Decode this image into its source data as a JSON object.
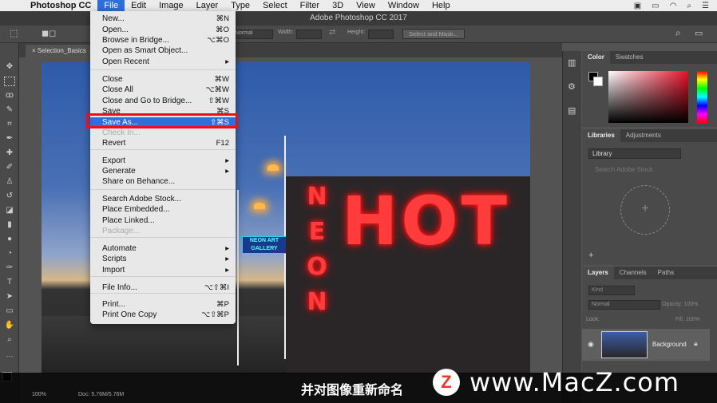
{
  "menubar": {
    "app": "Photoshop CC",
    "items": [
      "File",
      "Edit",
      "Image",
      "Layer",
      "Type",
      "Select",
      "Filter",
      "3D",
      "View",
      "Window",
      "Help"
    ]
  },
  "window": {
    "title": "Adobe Photoshop CC 2017",
    "doc_tab": "Selection_Basics"
  },
  "options": {
    "mode": "Normal",
    "width_label": "Width:",
    "height_label": "Height:",
    "select_mask": "Select and Mask..."
  },
  "file_menu": [
    {
      "label": "New...",
      "sc": "⌘N"
    },
    {
      "label": "Open...",
      "sc": "⌘O"
    },
    {
      "label": "Browse in Bridge...",
      "sc": "⌥⌘O"
    },
    {
      "label": "Open as Smart Object...",
      "sc": ""
    },
    {
      "label": "Open Recent",
      "sc": "▸"
    },
    {
      "label": "Close",
      "sc": "⌘W"
    },
    {
      "label": "Close All",
      "sc": "⌥⌘W"
    },
    {
      "label": "Close and Go to Bridge...",
      "sc": "⇧⌘W"
    },
    {
      "label": "Save",
      "sc": "⌘S"
    },
    {
      "label": "Save As...",
      "sc": "⇧⌘S"
    },
    {
      "label": "Check In...",
      "sc": ""
    },
    {
      "label": "Revert",
      "sc": "F12"
    },
    {
      "label": "Export",
      "sc": "▸"
    },
    {
      "label": "Generate",
      "sc": "▸"
    },
    {
      "label": "Share on Behance...",
      "sc": ""
    },
    {
      "label": "Search Adobe Stock...",
      "sc": ""
    },
    {
      "label": "Place Embedded...",
      "sc": ""
    },
    {
      "label": "Place Linked...",
      "sc": ""
    },
    {
      "label": "Package...",
      "sc": ""
    },
    {
      "label": "Automate",
      "sc": "▸"
    },
    {
      "label": "Scripts",
      "sc": "▸"
    },
    {
      "label": "Import",
      "sc": "▸"
    },
    {
      "label": "File Info...",
      "sc": "⌥⇧⌘I"
    },
    {
      "label": "Print...",
      "sc": "⌘P"
    },
    {
      "label": "Print One Copy",
      "sc": "⌥⇧⌘P"
    }
  ],
  "panels": {
    "color_tabs": [
      "Color",
      "Swatches"
    ],
    "lib_tabs": [
      "Libraries",
      "Adjustments"
    ],
    "library_select": "Library",
    "search_stock": "Search Adobe Stock",
    "layer_tabs": [
      "Layers",
      "Channels",
      "Paths"
    ],
    "kind": "Kind",
    "blend": "Normal",
    "opacity": "Opacity: 100%",
    "lock": "Lock:",
    "fill": "Fill: 100%",
    "layer_name": "Background"
  },
  "canvas": {
    "neon_word": "NEON",
    "hot_word": "HOT",
    "gallery_sign": "NEON ART GALLERY"
  },
  "status": {
    "zoom": "100%",
    "doc": "Doc: 5.76M/5.76M"
  },
  "caption": "并对图像重新命名",
  "watermark": {
    "logo": "Z",
    "text": "www.MacZ.com"
  }
}
